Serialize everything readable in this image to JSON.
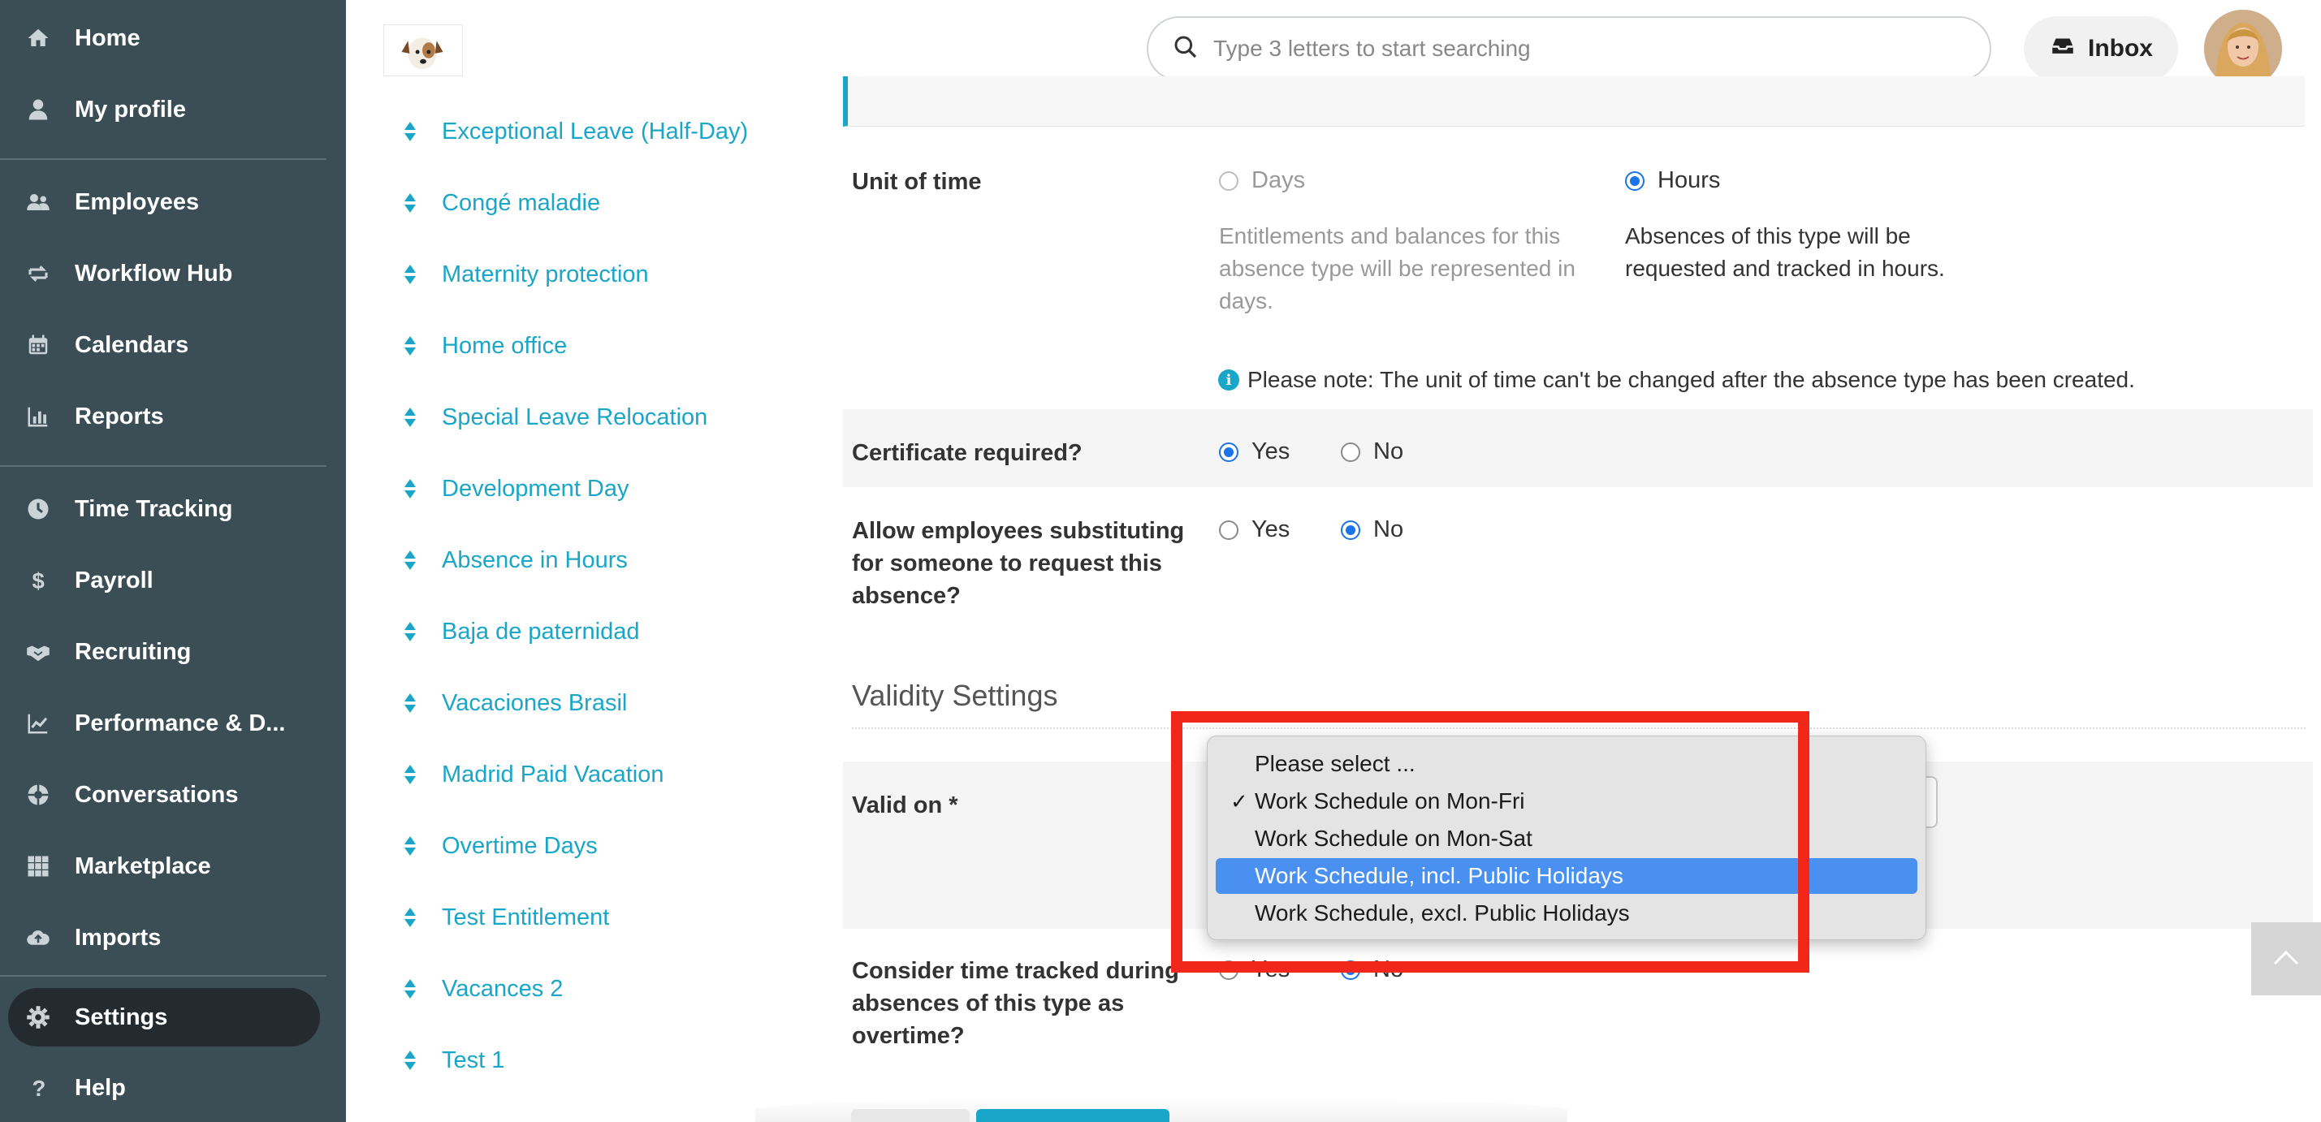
{
  "sidebar": {
    "items": [
      {
        "label": "Home",
        "icon": "home-icon"
      },
      {
        "label": "My profile",
        "icon": "user-icon"
      },
      {
        "label": "Employees",
        "icon": "users-icon"
      },
      {
        "label": "Workflow Hub",
        "icon": "workflow-icon"
      },
      {
        "label": "Calendars",
        "icon": "calendar-icon"
      },
      {
        "label": "Reports",
        "icon": "bar-chart-icon"
      },
      {
        "label": "Time Tracking",
        "icon": "clock-icon"
      },
      {
        "label": "Payroll",
        "icon": "dollar-icon"
      },
      {
        "label": "Recruiting",
        "icon": "handshake-icon"
      },
      {
        "label": "Performance & D...",
        "icon": "line-chart-icon"
      },
      {
        "label": "Conversations",
        "icon": "chat-icon"
      },
      {
        "label": "Marketplace",
        "icon": "grid-icon"
      },
      {
        "label": "Imports",
        "icon": "cloud-upload-icon"
      },
      {
        "label": "Settings",
        "icon": "gear-icon",
        "active": true
      },
      {
        "label": "Help",
        "icon": "question-icon"
      }
    ]
  },
  "header": {
    "search_placeholder": "Type 3 letters to start searching",
    "inbox_label": "Inbox"
  },
  "absence_types": [
    "Exceptional Leave (Half-Day)",
    "Congé maladie",
    "Maternity protection",
    "Home office",
    "Special Leave Relocation",
    "Development Day",
    "Absence in Hours",
    "Baja de paternidad",
    "Vacaciones Brasil",
    "Madrid Paid Vacation",
    "Overtime Days",
    "Test Entitlement",
    "Vacances 2",
    "Test 1"
  ],
  "form": {
    "unit_of_time": {
      "label": "Unit of time",
      "option_days": "Days",
      "option_hours": "Hours",
      "selected": "Hours",
      "days_desc": "Entitlements and balances for this absence type will be represented in days.",
      "hours_desc": "Absences of this type will be requested and tracked in hours.",
      "note": "Please note: The unit of time can't be changed after the absence type has been created."
    },
    "certificate": {
      "label": "Certificate required?",
      "yes": "Yes",
      "no": "No",
      "selected": "Yes"
    },
    "substitute": {
      "label": "Allow employees substituting for someone to request this absence?",
      "yes": "Yes",
      "no": "No",
      "selected": "No"
    },
    "validity_title": "Validity Settings",
    "valid_on": {
      "label": "Valid on *"
    },
    "overtime": {
      "label": "Consider time tracked during absences of this type as overtime?",
      "yes": "Yes",
      "no": "No",
      "selected": "No"
    }
  },
  "dropdown": {
    "options": [
      "Please select ...",
      "Work Schedule on Mon-Fri",
      "Work Schedule on Mon-Sat",
      "Work Schedule, incl. Public Holidays",
      "Work Schedule, excl. Public Holidays"
    ],
    "checked": "Work Schedule on Mon-Fri",
    "highlighted": "Work Schedule, incl. Public Holidays",
    "check_mark": "✓"
  },
  "colors": {
    "sidebar_bg": "#3b4d55",
    "accent": "#1aa6c8",
    "highlight": "#4a90f0",
    "annotation_red": "#f2261a"
  }
}
